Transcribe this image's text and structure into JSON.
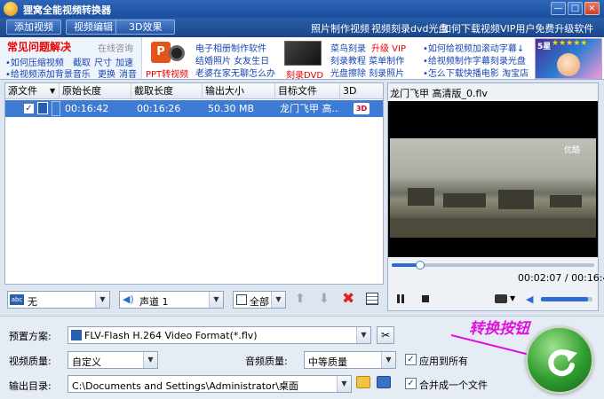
{
  "window": {
    "title": "狸窝全能视频转换器",
    "minimize": "—",
    "maximize": "□",
    "close": "×"
  },
  "toolbar": {
    "add_video": "添加视频",
    "edit_video": "视频编辑",
    "effect_3d": "3D效果",
    "links": [
      "照片制作视频",
      "视频刻录dvd光盘",
      "如何下载视频",
      "VIP用户免费升级软件"
    ]
  },
  "banner": {
    "faq_title": "常见问题解决",
    "online_consult": "在线咨询",
    "faq_line1": [
      "•如何压缩视频",
      "截取",
      "尺寸",
      "加速"
    ],
    "faq_line2": [
      "•给视频添加背景音乐",
      "更换",
      "消音"
    ],
    "ppt_caption": "PPT转视频",
    "album_line1": "电子相册制作软件",
    "album_line2": "结婚照片  女友生日",
    "album_line3": "老婆在家无聊怎么办",
    "dvd_caption": "刻录DVD",
    "burn_line1": "菜鸟刻录",
    "burn_vip": "升级 VIP",
    "burn_line2": "刻录教程  菜单制作",
    "burn_line3": "光盘擦除  刻录照片",
    "help_line1": "•如何给视频加滚动字幕↓",
    "help_line2": "•给视频制作字幕刻录光盘",
    "help_line3": "•怎么下载快播电影  淘宝店",
    "game_badge": "5星",
    "game_stars": "★★★★★"
  },
  "table": {
    "headers": [
      "源文件",
      "原始长度",
      "截取长度",
      "输出大小",
      "目标文件",
      "3D"
    ],
    "rows": [
      {
        "checked": "✓",
        "original_length": "00:16:42",
        "clip_length": "00:16:26",
        "output_size": "50.30 MB",
        "target": "龙门飞甲 高...",
        "d3": "3D"
      }
    ]
  },
  "preview": {
    "filename": "龙门飞甲 高清版_0.flv",
    "watermark": "优酷",
    "time_current": "00:02:07",
    "time_separator": " / ",
    "time_total": "00:16:42",
    "progress": 0.14,
    "volume": 0.92
  },
  "subtitle_bar": {
    "subtitle_value": "无",
    "audio_value": "声道 1",
    "range_value": "全部"
  },
  "settings": {
    "preset_label": "预置方案:",
    "preset_value": "FLV-Flash H.264 Video Format(*.flv)",
    "video_quality_label": "视频质量:",
    "video_quality_value": "自定义",
    "audio_quality_label": "音频质量:",
    "audio_quality_value": "中等质量",
    "apply_all": "应用到所有",
    "output_dir_label": "输出目录:",
    "output_dir_value": "C:\\Documents and Settings\\Administrator\\桌面",
    "merge_one": "合并成一个文件"
  },
  "annotation": {
    "convert_label": "转换按钮"
  },
  "colors": {
    "titlebar": "#2f66b9",
    "row_selected": "#3d7bd4",
    "convert_button": "#2e9c2e",
    "annotation": "#e010e0"
  }
}
